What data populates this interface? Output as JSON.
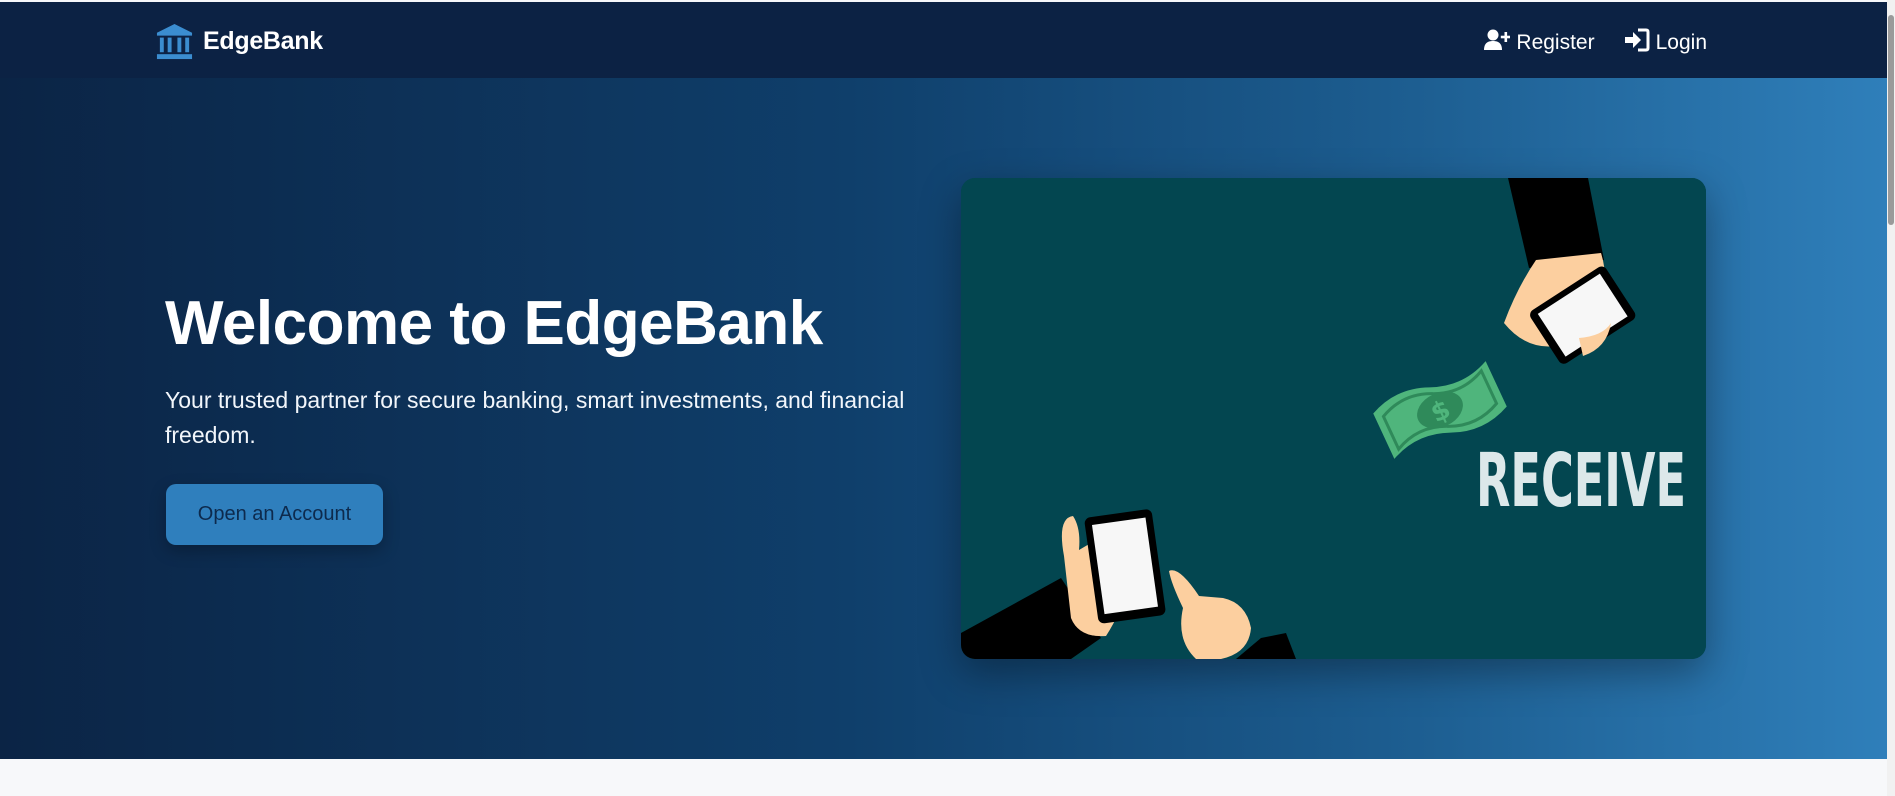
{
  "brand": {
    "name": "EdgeBank",
    "icon": "bank-icon"
  },
  "nav": {
    "register": {
      "label": "Register",
      "icon": "user-plus-icon"
    },
    "login": {
      "label": "Login",
      "icon": "sign-in-icon"
    }
  },
  "hero": {
    "title": "Welcome to EdgeBank",
    "subtitle": "Your trusted partner for secure banking, smart investments, and financial freedom.",
    "cta_label": "Open an Account",
    "illustration": {
      "word": "RECEIVE",
      "money_symbol": "$"
    }
  },
  "colors": {
    "navbar": "#0c2244",
    "hero_gradient_start": "#0b2445",
    "hero_gradient_end": "#2f7fba",
    "accent": "#2f7fbd",
    "illustration_bg": "#034650",
    "money_green": "#4fb57c"
  }
}
